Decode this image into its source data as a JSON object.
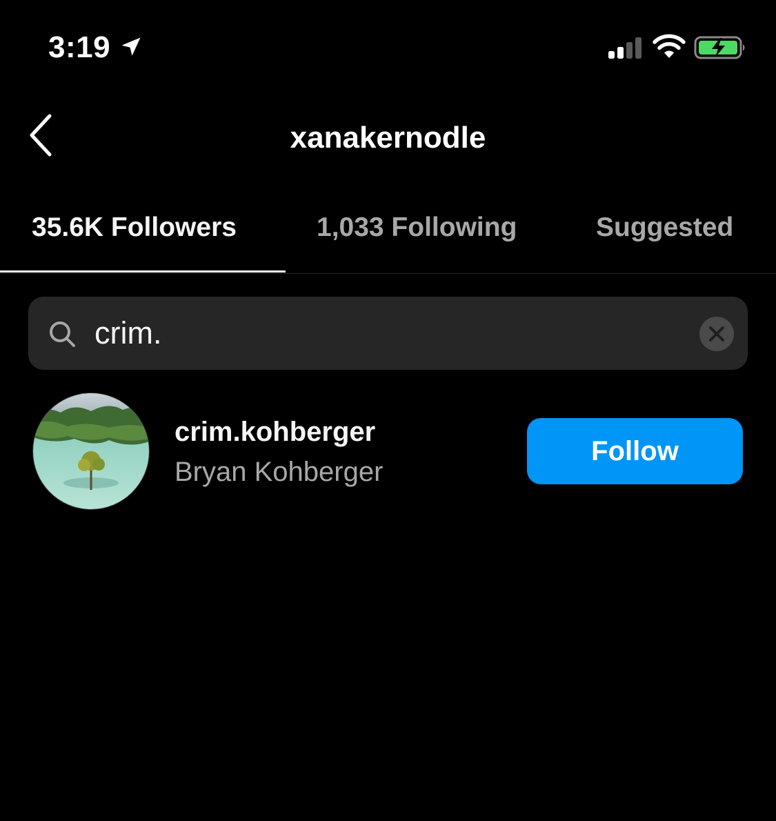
{
  "status_bar": {
    "time": "3:19",
    "icons": [
      "location-arrow-icon",
      "cellular-signal-icon",
      "wifi-icon",
      "battery-charging-icon"
    ],
    "battery_color": "#4cd964"
  },
  "header": {
    "title": "xanakernodle",
    "back_icon": "chevron-left-icon"
  },
  "tabs": [
    {
      "label": "35.6K Followers",
      "active": true
    },
    {
      "label": "1,033 Following",
      "active": false
    },
    {
      "label": "Suggested",
      "active": false
    }
  ],
  "search": {
    "value": "crim.",
    "icon": "search-icon",
    "clear_icon": "clear-x-icon"
  },
  "results": [
    {
      "username": "crim.kohberger",
      "full_name": "Bryan Kohberger",
      "button_label": "Follow"
    }
  ],
  "colors": {
    "background": "#000000",
    "accent": "#0095f6",
    "secondary_text": "#a8a8a8",
    "search_bg": "#262626"
  }
}
